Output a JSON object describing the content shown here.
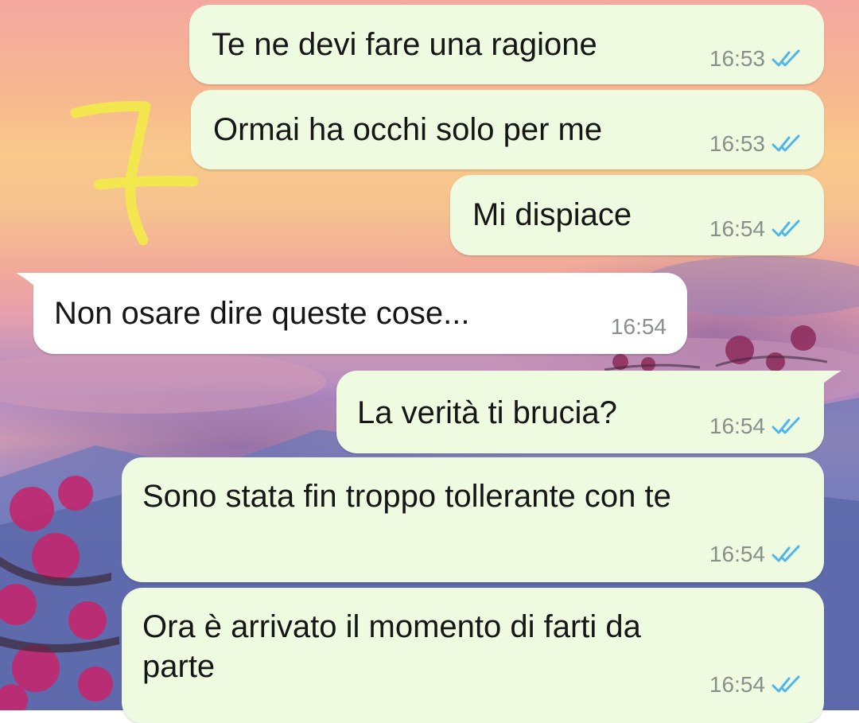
{
  "colors": {
    "outgoing_bubble": "#eefbe1",
    "incoming_bubble": "#ffffff",
    "read_ticks": "#4fb6ec",
    "timestamp": "#8a8f8a",
    "annotation": "#f2e94a"
  },
  "annotation": {
    "mark": "7"
  },
  "messages": [
    {
      "direction": "outgoing",
      "text": "Te ne devi fare una ragione",
      "time": "16:53",
      "status": "read-ticks-icon"
    },
    {
      "direction": "outgoing",
      "text": "Ormai ha occhi solo per me",
      "time": "16:53",
      "status": "read-ticks-icon"
    },
    {
      "direction": "outgoing",
      "text": "Mi dispiace",
      "time": "16:54",
      "status": "read-ticks-icon"
    },
    {
      "direction": "incoming",
      "text": "Non osare dire queste cose...",
      "time": "16:54"
    },
    {
      "direction": "outgoing",
      "text": "La verità ti brucia?",
      "time": "16:54",
      "status": "read-ticks-icon"
    },
    {
      "direction": "outgoing",
      "text": "Sono stata fin troppo tollerante con te",
      "time": "16:54",
      "status": "read-ticks-icon"
    },
    {
      "direction": "outgoing",
      "text": "Ora è arrivato il momento di farti da\nparte",
      "time": "16:54",
      "status": "read-ticks-icon"
    }
  ]
}
